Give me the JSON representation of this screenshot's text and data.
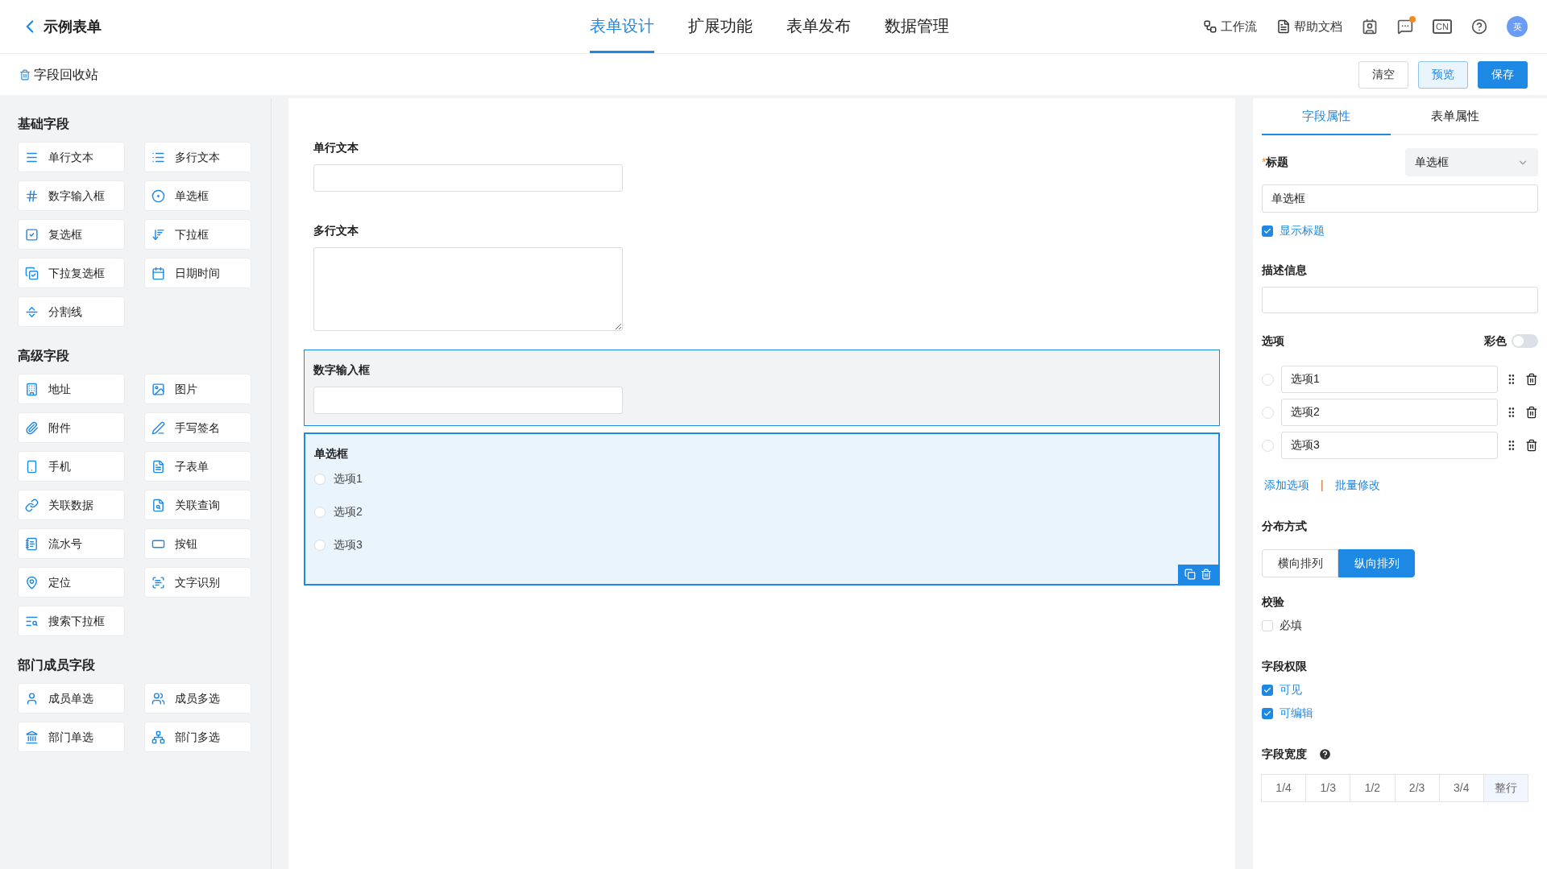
{
  "header": {
    "back_title": "示例表单",
    "tabs": [
      {
        "label": "表单设计",
        "selected": true
      },
      {
        "label": "扩展功能",
        "selected": false
      },
      {
        "label": "表单发布",
        "selected": false
      },
      {
        "label": "数据管理",
        "selected": false
      }
    ],
    "tools": [
      {
        "kind": "workflow",
        "label": "工作流"
      },
      {
        "kind": "docs",
        "label": "帮助文档"
      }
    ],
    "icons": [
      {
        "kind": "contact"
      },
      {
        "kind": "message",
        "badge": true
      },
      {
        "kind": "lang",
        "text": "CN"
      },
      {
        "kind": "help"
      }
    ],
    "avatar": "英"
  },
  "toolbar": {
    "recycle": "字段回收站",
    "buttons": [
      {
        "kind": "plain",
        "label": "清空"
      },
      {
        "kind": "outline",
        "label": "预览"
      },
      {
        "kind": "primary",
        "label": "保存"
      }
    ]
  },
  "palette": [
    {
      "title": "基础字段",
      "items": [
        {
          "kind": "single_line",
          "label": "单行文本"
        },
        {
          "kind": "multi_line",
          "label": "多行文本"
        },
        {
          "kind": "number",
          "label": "数字输入框"
        },
        {
          "kind": "radio",
          "label": "单选框"
        },
        {
          "kind": "checkbox",
          "label": "复选框"
        },
        {
          "kind": "dropdown",
          "label": "下拉框"
        },
        {
          "kind": "multi_dropdown",
          "label": "下拉复选框"
        },
        {
          "kind": "datetime",
          "label": "日期时间"
        },
        {
          "kind": "divider",
          "label": "分割线"
        }
      ]
    },
    {
      "title": "高级字段",
      "items": [
        {
          "kind": "address",
          "label": "地址"
        },
        {
          "kind": "image",
          "label": "图片"
        },
        {
          "kind": "attachment",
          "label": "附件"
        },
        {
          "kind": "signature",
          "label": "手写签名"
        },
        {
          "kind": "phone",
          "label": "手机"
        },
        {
          "kind": "subform",
          "label": "子表单"
        },
        {
          "kind": "linked_data",
          "label": "关联数据"
        },
        {
          "kind": "linked_query",
          "label": "关联查询"
        },
        {
          "kind": "serial",
          "label": "流水号"
        },
        {
          "kind": "button",
          "label": "按钮"
        },
        {
          "kind": "location",
          "label": "定位"
        },
        {
          "kind": "ocr",
          "label": "文字识别"
        },
        {
          "kind": "search_dropdown",
          "label": "搜索下拉框"
        }
      ]
    },
    {
      "title": "部门成员字段",
      "items": [
        {
          "kind": "member_single",
          "label": "成员单选"
        },
        {
          "kind": "member_multi",
          "label": "成员多选"
        },
        {
          "kind": "dept_single",
          "label": "部门单选"
        },
        {
          "kind": "dept_multi",
          "label": "部门多选"
        }
      ]
    }
  ],
  "canvas": {
    "fields": [
      {
        "kind": "text",
        "label": "单行文本",
        "hovered": false,
        "selected": false
      },
      {
        "kind": "textarea",
        "label": "多行文本",
        "hovered": false,
        "selected": false
      },
      {
        "kind": "number",
        "label": "数字输入框",
        "hovered": true,
        "selected": false
      },
      {
        "kind": "radio",
        "label": "单选框",
        "selected": true,
        "options": [
          {
            "label": "选项1",
            "selected": false
          },
          {
            "label": "选项2",
            "selected": false
          },
          {
            "label": "选项3",
            "selected": false
          }
        ]
      }
    ]
  },
  "properties": {
    "tabs": [
      {
        "label": "字段属性",
        "selected": true
      },
      {
        "label": "表单属性",
        "selected": false
      }
    ],
    "title_label": "标题",
    "required_mark": "*",
    "type_select": "单选框",
    "title_value": "单选框",
    "show_title": {
      "label": "显示标题",
      "checked": true
    },
    "description_label": "描述信息",
    "options_label": "选项",
    "color_toggle": {
      "label": "彩色",
      "on": false
    },
    "options": [
      {
        "value": "选项1",
        "selected": false
      },
      {
        "value": "选项2",
        "selected": false
      },
      {
        "value": "选项3",
        "selected": false
      }
    ],
    "add_option": "添加选项",
    "separator": "|",
    "batch_edit": "批量修改",
    "layout_label": "分布方式",
    "layouts": [
      {
        "label": "横向排列",
        "selected": false
      },
      {
        "label": "纵向排列",
        "selected": true
      }
    ],
    "validation_label": "校验",
    "validations": [
      {
        "label": "必填",
        "checked": false
      }
    ],
    "permission_label": "字段权限",
    "permissions": [
      {
        "label": "可见",
        "checked": true
      },
      {
        "label": "可编辑",
        "checked": true
      }
    ],
    "width_label": "字段宽度",
    "widths": [
      {
        "label": "1/4",
        "selected": false
      },
      {
        "label": "1/3",
        "selected": false
      },
      {
        "label": "1/2",
        "selected": false
      },
      {
        "label": "2/3",
        "selected": false
      },
      {
        "label": "3/4",
        "selected": false
      },
      {
        "label": "整行",
        "selected": true
      }
    ]
  }
}
